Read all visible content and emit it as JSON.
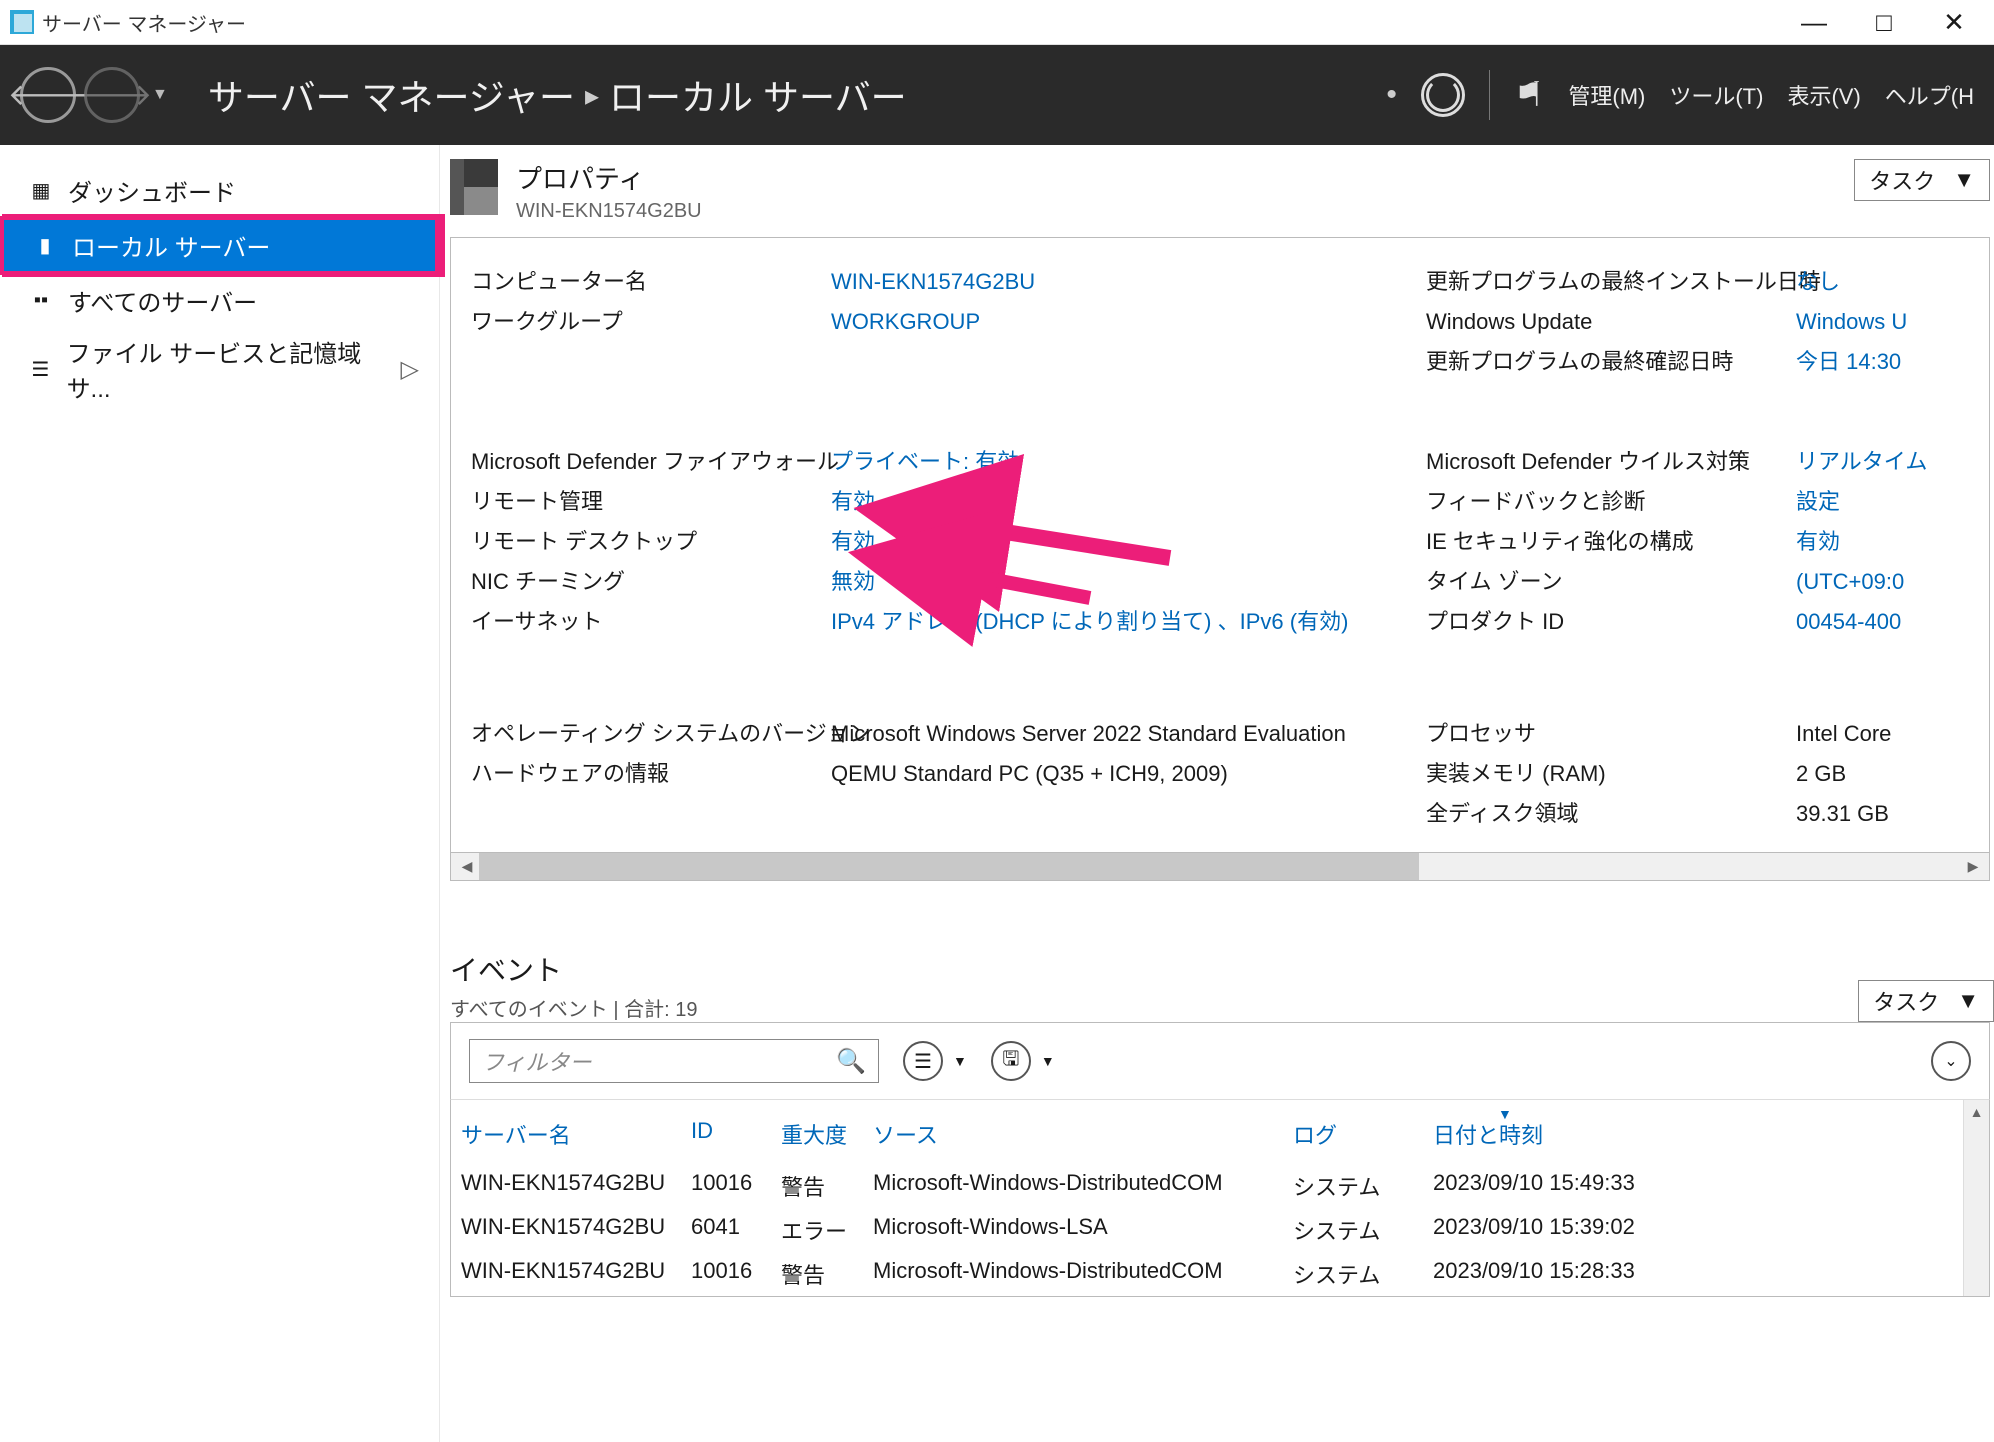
{
  "titlebar": {
    "title": "サーバー マネージャー"
  },
  "header": {
    "breadcrumb_root": "サーバー マネージャー",
    "breadcrumb_page": "ローカル サーバー",
    "menu": {
      "manage": "管理(M)",
      "tools": "ツール(T)",
      "view": "表示(V)",
      "help": "ヘルプ(H"
    }
  },
  "sidebar": {
    "items": [
      {
        "label": "ダッシュボード",
        "icon": "dashboard"
      },
      {
        "label": "ローカル サーバー",
        "icon": "local-server",
        "selected": true
      },
      {
        "label": "すべてのサーバー",
        "icon": "all-servers"
      },
      {
        "label": "ファイル サービスと記憶域サ...",
        "icon": "files",
        "expandable": true
      }
    ]
  },
  "properties": {
    "title": "プロパティ",
    "subtitle": "WIN-EKN1574G2BU",
    "tasks_label": "タスク",
    "group1": {
      "left": [
        {
          "label": "コンピューター名",
          "value": "WIN-EKN1574G2BU",
          "link": true
        },
        {
          "label": "ワークグループ",
          "value": "WORKGROUP",
          "link": true
        }
      ],
      "right": [
        {
          "label": "更新プログラムの最終インストール日時",
          "value": "なし",
          "link": true
        },
        {
          "label": "Windows Update",
          "value": "Windows U",
          "link": true
        },
        {
          "label": "更新プログラムの最終確認日時",
          "value": "今日 14:30",
          "link": true
        }
      ]
    },
    "group2": {
      "left": [
        {
          "label": "Microsoft Defender ファイアウォール",
          "value": "プライベート: 有効",
          "link": true
        },
        {
          "label": "リモート管理",
          "value": "有効",
          "link": true
        },
        {
          "label": "リモート デスクトップ",
          "value": "有効",
          "link": true
        },
        {
          "label": "NIC チーミング",
          "value": "無効",
          "link": true
        },
        {
          "label": "イーサネット",
          "value": "IPv4 アドレス (DHCP により割り当て) 、IPv6 (有効)",
          "link": true
        }
      ],
      "right": [
        {
          "label": "Microsoft Defender ウイルス対策",
          "value": "リアルタイム",
          "link": true
        },
        {
          "label": "フィードバックと診断",
          "value": "設定",
          "link": true
        },
        {
          "label": "IE セキュリティ強化の構成",
          "value": "有効",
          "link": true
        },
        {
          "label": "タイム ゾーン",
          "value": "(UTC+09:0",
          "link": true
        },
        {
          "label": "プロダクト ID",
          "value": "00454-400",
          "link": true
        }
      ]
    },
    "group3": {
      "left": [
        {
          "label": "オペレーティング システムのバージョン",
          "value": "Microsoft Windows Server 2022 Standard Evaluation"
        },
        {
          "label": "ハードウェアの情報",
          "value": "QEMU Standard PC (Q35 + ICH9, 2009)"
        }
      ],
      "right": [
        {
          "label": "プロセッサ",
          "value": "Intel Core "
        },
        {
          "label": "実装メモリ (RAM)",
          "value": "2 GB"
        },
        {
          "label": "全ディスク領域",
          "value": "39.31 GB"
        }
      ]
    }
  },
  "events": {
    "title": "イベント",
    "subtitle": "すべてのイベント | 合計: 19",
    "tasks_label": "タスク",
    "filter_placeholder": "フィルター",
    "columns": {
      "server": "サーバー名",
      "id": "ID",
      "severity": "重大度",
      "source": "ソース",
      "log": "ログ",
      "date": "日付と時刻"
    },
    "rows": [
      {
        "server": "WIN-EKN1574G2BU",
        "id": "10016",
        "severity": "警告",
        "source": "Microsoft-Windows-DistributedCOM",
        "log": "システム",
        "date": "2023/09/10 15:49:33"
      },
      {
        "server": "WIN-EKN1574G2BU",
        "id": "6041",
        "severity": "エラー",
        "source": "Microsoft-Windows-LSA",
        "log": "システム",
        "date": "2023/09/10 15:39:02"
      },
      {
        "server": "WIN-EKN1574G2BU",
        "id": "10016",
        "severity": "警告",
        "source": "Microsoft-Windows-DistributedCOM",
        "log": "システム",
        "date": "2023/09/10 15:28:33"
      }
    ]
  }
}
